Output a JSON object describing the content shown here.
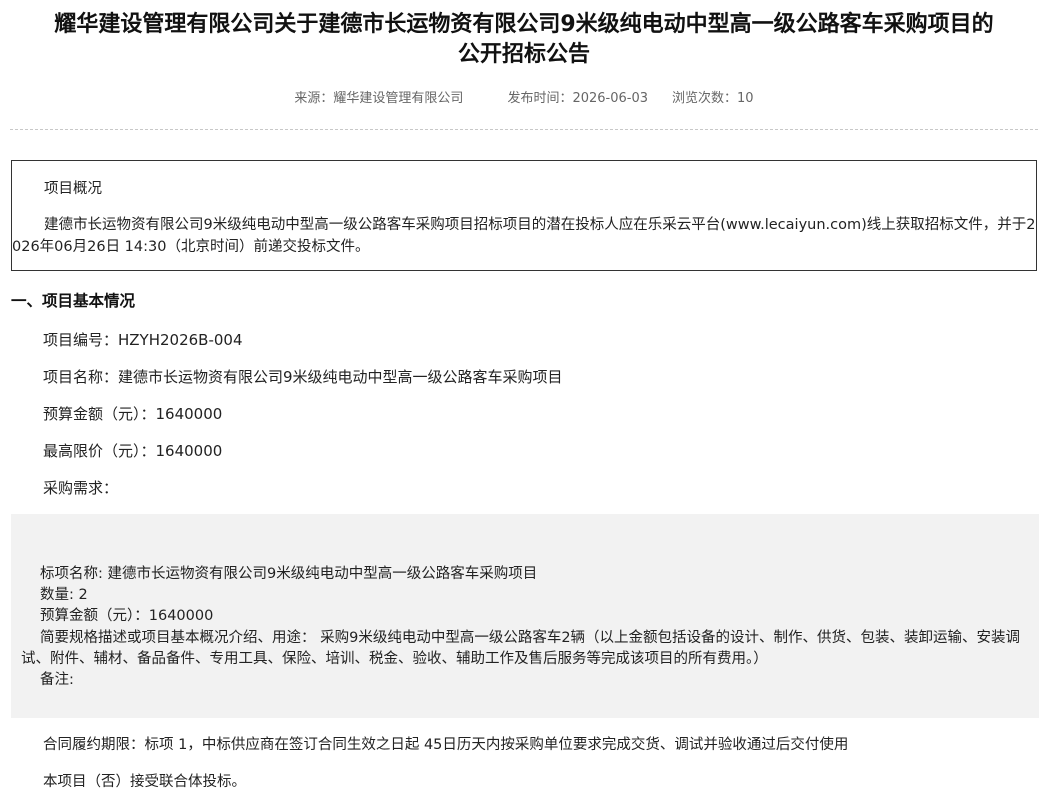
{
  "title": {
    "line1": "耀华建设管理有限公司关于建德市长运物资有限公司9米级纯电动中型高一级公路客车采购项目的",
    "line2": "公开招标公告"
  },
  "meta": {
    "source_label": "来源：",
    "source": "耀华建设管理有限公司",
    "publish_label": "发布时间：",
    "publish_date": "2026-06-03",
    "views_label": "浏览次数：",
    "views": "10"
  },
  "overview": {
    "title": "项目概况",
    "body": "建德市长运物资有限公司9米级纯电动中型高一级公路客车采购项目招标项目的潜在投标人应在乐采云平台(www.lecaiyun.com)线上获取招标文件，并于2026年06月26日 14:30（北京时间）前递交投标文件。"
  },
  "section1": {
    "title": "一、项目基本情况",
    "project_no": "项目编号：HZYH2026B-004",
    "project_name": "项目名称：建德市长运物资有限公司9米级纯电动中型高一级公路客车采购项目",
    "budget": "预算金额（元）：1640000",
    "max_price": "最高限价（元）：1640000",
    "requirement_label": "采购需求："
  },
  "lot": {
    "name": "标项名称: 建德市长运物资有限公司9米级纯电动中型高一级公路客车采购项目",
    "quantity": "数量: 2",
    "budget": "预算金额（元）：1640000",
    "description": "简要规格描述或项目基本概况介绍、用途： 采购9米级纯电动中型高一级公路客车2辆（以上金额包括设备的设计、制作、供货、包装、装卸运输、安装调试、附件、辅材、备品备件、专用工具、保险、培训、税金、验收、辅助工作及售后服务等完成该项目的所有费用。）",
    "remark": "备注:"
  },
  "contract": {
    "term": "合同履约期限：标项 1，中标供应商在签订合同生效之日起 45日历天内按采购单位要求完成交货、调试并验收通过后交付使用",
    "consortium": "本项目（否）接受联合体投标。"
  }
}
